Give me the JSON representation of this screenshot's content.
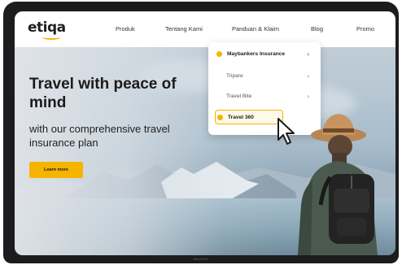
{
  "brand": {
    "logo_text": "etiqa"
  },
  "nav": {
    "items": [
      {
        "label": "Produk"
      },
      {
        "label": "Tentang Kami"
      },
      {
        "label": "Panduan & Klaim"
      },
      {
        "label": "Blog"
      },
      {
        "label": "Promo"
      }
    ]
  },
  "dropdown": {
    "header": "Maybankers Insurance",
    "items": [
      {
        "label": "Tripare"
      },
      {
        "label": "Travel Bite"
      },
      {
        "label": "Travel 360"
      }
    ]
  },
  "hero": {
    "title": "Travel with peace of mind",
    "subtitle": "with our comprehensive travel insurance plan",
    "cta_label": "Learn more"
  },
  "device": {
    "label": "BAXIEM"
  },
  "colors": {
    "accent": "#f5b400",
    "text": "#1b1b1b"
  },
  "icons": [
    "chevron-right-icon",
    "cursor-icon",
    "dot-icon"
  ]
}
